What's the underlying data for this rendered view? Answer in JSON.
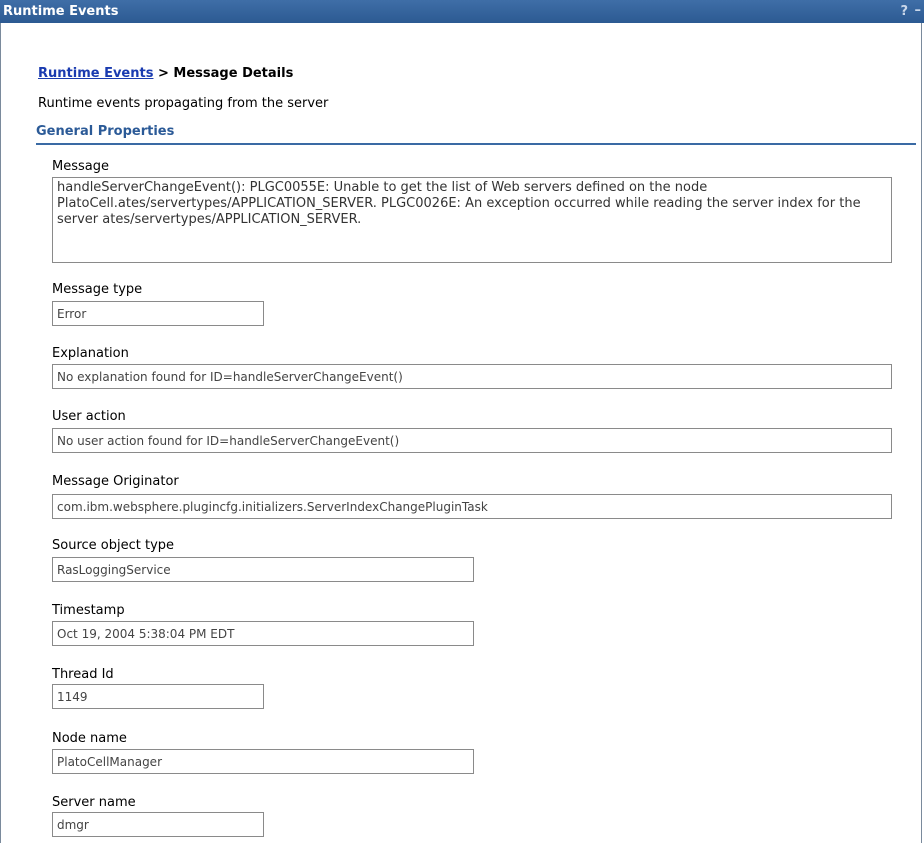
{
  "titlebar": {
    "title": "Runtime Events",
    "help": "?",
    "minimize": "–"
  },
  "breadcrumb": {
    "link": "Runtime Events",
    "separator": " > ",
    "current": "Message Details"
  },
  "description": "Runtime events propagating from the server",
  "section": "General Properties",
  "fields": {
    "message": {
      "label": "Message",
      "value": "handleServerChangeEvent(): PLGC0055E: Unable to get the list of Web servers defined on the node PlatoCell.ates/servertypes/APPLICATION_SERVER. PLGC0026E: An exception occurred while reading the server index for the server ates/servertypes/APPLICATION_SERVER."
    },
    "message_type": {
      "label": "Message type",
      "value": "Error"
    },
    "explanation": {
      "label": "Explanation",
      "value": "No explanation found for ID=handleServerChangeEvent()"
    },
    "user_action": {
      "label": "User action",
      "value": "No user action found for ID=handleServerChangeEvent()"
    },
    "originator": {
      "label": "Message Originator",
      "value": "com.ibm.websphere.plugincfg.initializers.ServerIndexChangePluginTask"
    },
    "source_type": {
      "label": "Source object type",
      "value": "RasLoggingService"
    },
    "timestamp": {
      "label": "Timestamp",
      "value": "Oct 19, 2004 5:38:04 PM EDT"
    },
    "thread_id": {
      "label": "Thread Id",
      "value": "1149"
    },
    "node_name": {
      "label": "Node name",
      "value": "PlatoCellManager"
    },
    "server_name": {
      "label": "Server name",
      "value": "dmgr"
    }
  }
}
